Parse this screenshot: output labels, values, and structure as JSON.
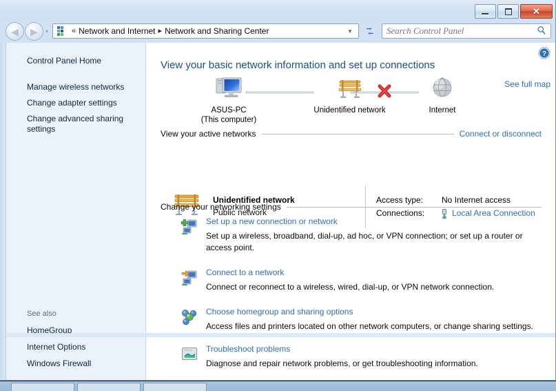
{
  "window": {
    "titlebar": {
      "minimize_label": "Minimize",
      "maximize_label": "Maximize",
      "close_label": "Close",
      "close_glyph": "✕"
    },
    "navigation": {
      "back_label": "Back",
      "back_glyph": "◀",
      "forward_label": "Forward",
      "forward_glyph": "▶",
      "recent_pages_glyph": "▾"
    },
    "address_bar": {
      "prefix_glyph": "«",
      "crumbs": [
        "Network and Internet",
        "Network and Sharing Center"
      ],
      "separator_glyph": "▸",
      "dropdown_glyph": "▼"
    },
    "refresh_label": "Refresh",
    "search": {
      "placeholder": "Search Control Panel",
      "value": ""
    },
    "help_label": "Help"
  },
  "sidebar": {
    "home_link": "Control Panel Home",
    "tasks": [
      "Manage wireless networks",
      "Change adapter settings",
      "Change advanced sharing settings"
    ],
    "see_also_heading": "See also",
    "see_also": [
      "HomeGroup",
      "Internet Options",
      "Windows Firewall"
    ]
  },
  "main": {
    "heading": "View your basic network information and set up connections",
    "see_full_map": "See full map",
    "network_map": {
      "computer_name": "ASUS-PC",
      "computer_sub": "(This computer)",
      "network_name": "Unidentified network",
      "internet_name": "Internet",
      "internet_blocked": true
    },
    "active_networks": {
      "section_title": "View your active networks",
      "right_link": "Connect or disconnect",
      "network_name": "Unidentified network",
      "network_type": "Public network",
      "access_type_label": "Access type:",
      "access_type_value": "No Internet access",
      "connections_label": "Connections:",
      "connection_link": "Local Area Connection"
    },
    "settings": {
      "section_title": "Change your networking settings",
      "items": [
        {
          "icon": "setup-new-connection-icon",
          "link": "Set up a new connection or network",
          "desc": "Set up a wireless, broadband, dial-up, ad hoc, or VPN connection; or set up a router or access point."
        },
        {
          "icon": "connect-to-network-icon",
          "link": "Connect to a network",
          "desc": "Connect or reconnect to a wireless, wired, dial-up, or VPN network connection."
        },
        {
          "icon": "homegroup-icon",
          "link": "Choose homegroup and sharing options",
          "desc": "Access files and printers located on other network computers, or change sharing settings."
        },
        {
          "icon": "troubleshoot-icon",
          "link": "Troubleshoot problems",
          "desc": "Diagnose and repair network problems, or get troubleshooting information."
        }
      ]
    }
  },
  "colors": {
    "link": "#2f6fb5",
    "heading": "#1a4f8a",
    "sidebar_bg": "#eaf2fb",
    "close_button": "#c8442a",
    "error_x": "#cc2222"
  }
}
